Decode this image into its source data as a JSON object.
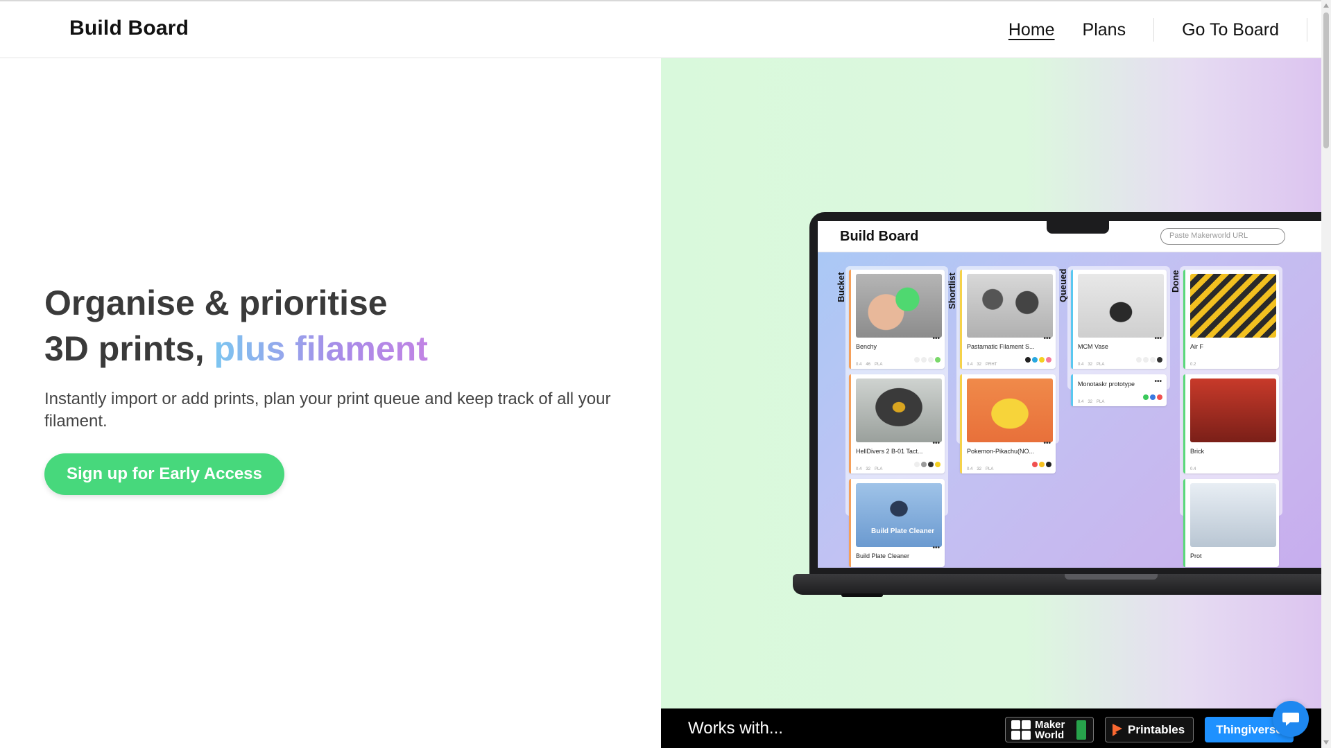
{
  "header": {
    "brand": "Build Board",
    "nav": {
      "home": "Home",
      "plans": "Plans",
      "go_to_board": "Go To Board"
    }
  },
  "hero": {
    "headline_line1": "Organise & prioritise",
    "headline_line2_plain": "3D prints, ",
    "headline_line2_accent": "plus filament",
    "subtext": "Instantly import or add prints, plan your print queue and keep track of all your filament.",
    "cta_label": "Sign up for Early Access"
  },
  "preview_app": {
    "title": "Build Board",
    "search_placeholder": "Paste Makerworld URL",
    "columns": [
      {
        "label": "Bucket",
        "cards": [
          {
            "title": "Benchy",
            "meta": [
              "0.4",
              "46",
              "PLA"
            ],
            "stripe": "#f5a05a",
            "dots": [
              "#ffffff",
              "#ffffff",
              "#ffffff",
              "#7ad86a"
            ]
          },
          {
            "title": "HellDivers 2 B-01 Tact...",
            "meta": [
              "0.4",
              "32",
              "PLA"
            ],
            "stripe": "#f5a05a",
            "dots": [
              "#ffffff",
              "#9a9a9a",
              "#333333",
              "#f5d020"
            ]
          },
          {
            "title": "Build Plate Cleaner",
            "meta": [],
            "stripe": "#f5a05a",
            "dots": []
          }
        ]
      },
      {
        "label": "Shortlist",
        "cards": [
          {
            "title": "Pastamatic  Filament S...",
            "meta": [
              "0.4",
              "32",
              "PRHT"
            ],
            "stripe": "#f5d24a",
            "dots": [
              "#222222",
              "#29a8e0",
              "#f5d020",
              "#f57a9a"
            ]
          },
          {
            "title": "Pokemon-Pikachu(NO...",
            "meta": [
              "0.4",
              "32",
              "PLA"
            ],
            "stripe": "#f5d24a",
            "dots": [
              "#f05050",
              "#f5c020",
              "#222222"
            ]
          }
        ]
      },
      {
        "label": "Queued",
        "cards": [
          {
            "title": "MCM Vase",
            "meta": [
              "0.4",
              "32",
              "PLA"
            ],
            "stripe": "#5ac8f0",
            "dots": [
              "#ffffff",
              "#ffffff",
              "#ffffff",
              "#333333"
            ]
          },
          {
            "title": "Monotaskr prototype",
            "meta": [
              "0.4",
              "32",
              "PLA"
            ],
            "stripe": "#5ac8f0",
            "dots": [
              "#3ac85a",
              "#3a7ae0",
              "#f05050"
            ]
          }
        ]
      },
      {
        "label": "Done",
        "cards": [
          {
            "title": "Air F",
            "meta": [
              "0.2"
            ],
            "stripe": "#5ad87a",
            "dots": []
          },
          {
            "title": "Brick",
            "meta": [
              "0.4"
            ],
            "stripe": "#5ad87a",
            "dots": []
          },
          {
            "title": "Prot",
            "meta": [],
            "stripe": "#5ad87a",
            "dots": []
          }
        ]
      }
    ],
    "thumb_label_build_plate": "Build Plate Cleaner"
  },
  "works_with": {
    "label": "Works with...",
    "badges": {
      "makerworld": "Maker World",
      "printables": "Printables",
      "thingiverse": "Thingiverse"
    }
  },
  "colors": {
    "cta": "#47d87c",
    "accent_gradient_start": "#7cc6f0",
    "accent_gradient_end": "#c184e4",
    "chat_button": "#1e88f0",
    "thingiverse": "#1e91ff"
  }
}
